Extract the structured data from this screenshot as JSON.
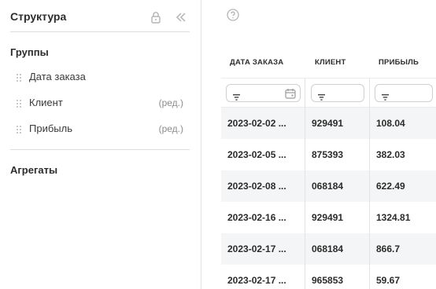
{
  "panel": {
    "title": "Структура",
    "groups_title": "Группы",
    "aggregates_title": "Агрегаты",
    "group_fields": [
      {
        "label": "Дата заказа",
        "edit": ""
      },
      {
        "label": "Клиент",
        "edit": "(ред.)"
      },
      {
        "label": "Прибыль",
        "edit": "(ред.)"
      }
    ]
  },
  "table": {
    "headers": [
      "ДАТА ЗАКАЗА",
      "КЛИЕНТ",
      "ПРИБЫЛЬ"
    ],
    "rows": [
      [
        "2023-02-02 ...",
        "929491",
        "108.04"
      ],
      [
        "2023-02-05 ...",
        "875393",
        "382.03"
      ],
      [
        "2023-02-08 ...",
        "068184",
        "622.49"
      ],
      [
        "2023-02-16 ...",
        "929491",
        "1324.81"
      ],
      [
        "2023-02-17 ...",
        "068184",
        "866.7"
      ],
      [
        "2023-02-17 ...",
        "965853",
        "59.67"
      ]
    ]
  },
  "colors": {
    "row_shade": "#f4f5f6",
    "border": "#e3e3e3",
    "muted_icon": "#b3b3b3"
  },
  "icons": {
    "lock": "lock-icon",
    "collapse": "double-chevron-left-icon",
    "help": "question-circle-icon",
    "filter": "filter-icon",
    "calendar": "calendar-icon",
    "drag": "drag-handle-icon"
  }
}
